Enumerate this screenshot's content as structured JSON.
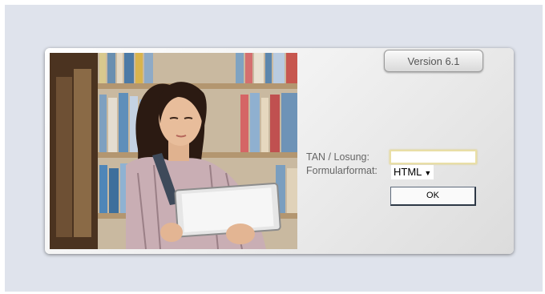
{
  "version_label": "Version 6.1",
  "form": {
    "tan_label": "TAN / Losung:",
    "tan_value": "",
    "format_label": "Formularformat:",
    "format_selected": "HTML",
    "ok_label": "OK"
  },
  "colors": {
    "page_background": "#dfe3ec",
    "input_border": "#e9dfa6",
    "ok_border": "#2d3846"
  }
}
